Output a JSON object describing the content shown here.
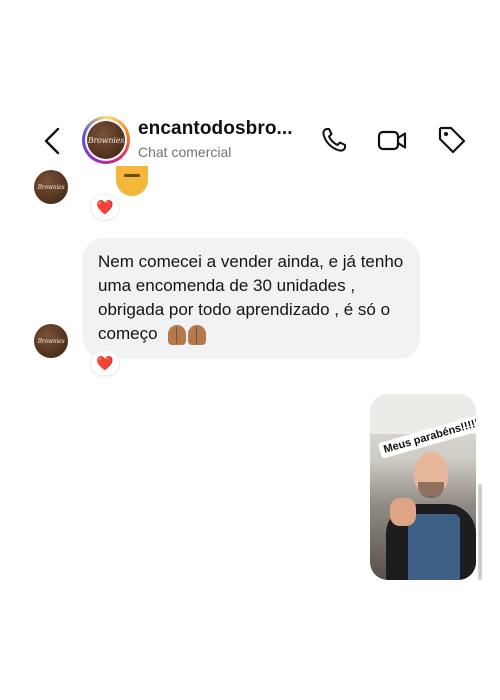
{
  "header": {
    "username": "encantodosbro...",
    "subtitle": "Chat comercial",
    "avatar_logo_text": "Brownies"
  },
  "messages": [
    {
      "type": "emoji_partial",
      "emoji_icon": "smiling-face-emoji",
      "reaction": "❤️"
    },
    {
      "type": "text",
      "text": "Nem comecei a vender ainda, e já tenho uma encomenda de 30 unidades , obrigada por todo aprendizado , é só o começo",
      "emoji_icon": "folded-hands-emoji",
      "reaction": "❤️"
    },
    {
      "type": "video",
      "sticker_text": "Meus parabéns!!!!!!"
    }
  ],
  "colors": {
    "bubble_bg": "#f1f2f4",
    "heart": "#e8283b",
    "subtitle": "#737373"
  }
}
